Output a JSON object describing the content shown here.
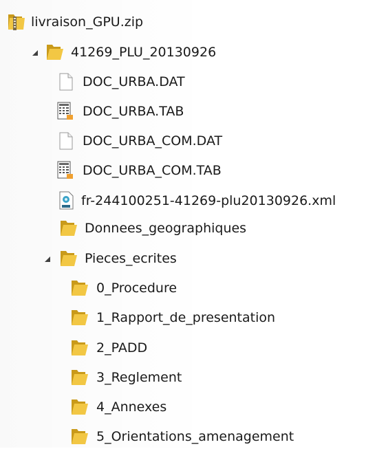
{
  "tree": {
    "root": {
      "label": "livraison_GPU.zip",
      "icon": "zip-folder-icon"
    },
    "folder": {
      "label": "41269_PLU_20130926",
      "icon": "folder-icon",
      "expanded": true
    },
    "files": [
      {
        "label": "DOC_URBA.DAT",
        "icon": "blank-file-icon"
      },
      {
        "label": "DOC_URBA.TAB",
        "icon": "table-file-icon"
      },
      {
        "label": "DOC_URBA_COM.DAT",
        "icon": "blank-file-icon"
      },
      {
        "label": "DOC_URBA_COM.TAB",
        "icon": "table-file-icon"
      },
      {
        "label": "fr-244100251-41269-plu20130926.xml",
        "icon": "xml-file-icon"
      }
    ],
    "subfolders": [
      {
        "label": "Donnees_geographiques",
        "icon": "folder-icon"
      },
      {
        "label": "Pieces_ecrites",
        "icon": "folder-icon",
        "expanded": true
      }
    ],
    "pieces": [
      {
        "label": "0_Procedure",
        "icon": "folder-icon"
      },
      {
        "label": "1_Rapport_de_presentation",
        "icon": "folder-icon"
      },
      {
        "label": "2_PADD",
        "icon": "folder-icon"
      },
      {
        "label": "3_Reglement",
        "icon": "folder-icon"
      },
      {
        "label": "4_Annexes",
        "icon": "folder-icon"
      },
      {
        "label": "5_Orientations_amenagement",
        "icon": "folder-icon"
      }
    ],
    "colors": {
      "folder": "#f2c744",
      "folder_dark": "#c99a1a",
      "text": "#1a1a1a",
      "expander": "#404040"
    }
  }
}
